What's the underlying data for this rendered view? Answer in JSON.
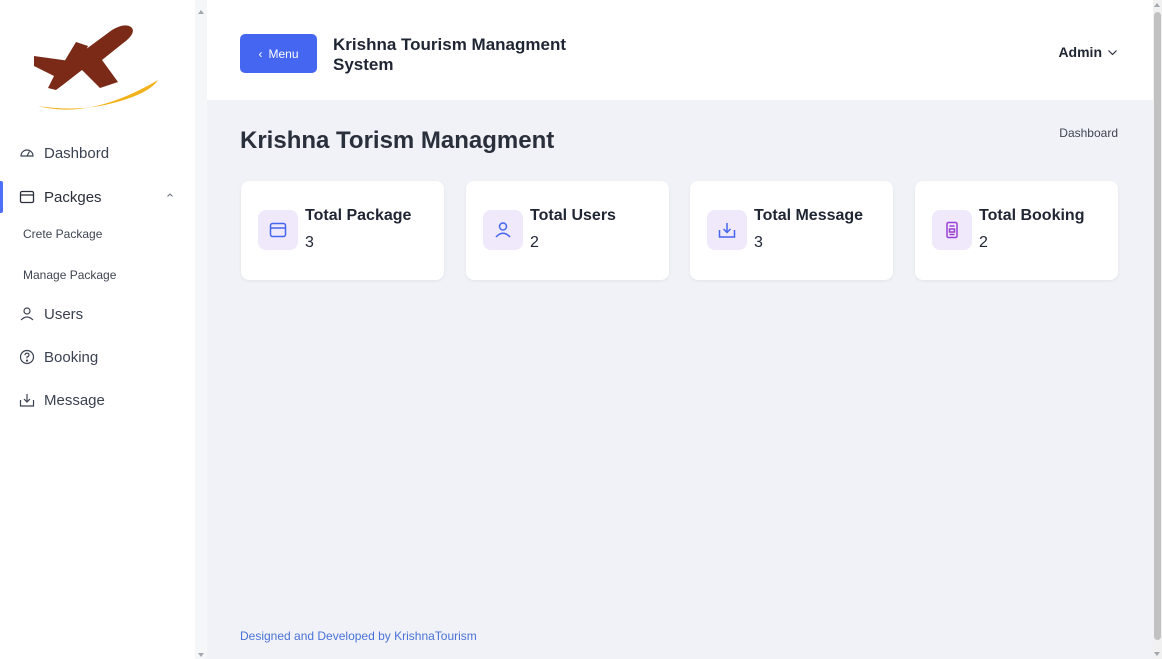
{
  "header": {
    "menu_label": "Menu",
    "system_title": "Krishna Tourism Managment System",
    "admin_label": "Admin"
  },
  "sidebar": {
    "items": [
      {
        "label": "Dashbord",
        "icon": "dashboard-gauge-icon"
      },
      {
        "label": "Packges",
        "icon": "calendar-icon",
        "expanded": true,
        "children": [
          {
            "label": "Crete Package"
          },
          {
            "label": "Manage Package"
          }
        ]
      },
      {
        "label": "Users",
        "icon": "user-icon"
      },
      {
        "label": "Booking",
        "icon": "question-circle-icon"
      },
      {
        "label": "Message",
        "icon": "download-icon"
      }
    ]
  },
  "main": {
    "page_title": "Krishna Torism Managment",
    "breadcrumb": "Dashboard",
    "cards": [
      {
        "label": "Total Package",
        "value": "3",
        "icon": "calendar-icon"
      },
      {
        "label": "Total Users",
        "value": "2",
        "icon": "user-icon"
      },
      {
        "label": "Total Message",
        "value": "3",
        "icon": "download-icon"
      },
      {
        "label": "Total Booking",
        "value": "2",
        "icon": "book-icon"
      }
    ]
  },
  "footer": {
    "text": "Designed and Developed by KrishnaTourism"
  },
  "colors": {
    "accent": "#4566f0",
    "icon_tile": "#efe9fb",
    "icon_stroke": "#4566f0",
    "booking_icon": "#9b3fd6",
    "footer_link": "#4a72d8",
    "background": "#f0f2f7"
  }
}
